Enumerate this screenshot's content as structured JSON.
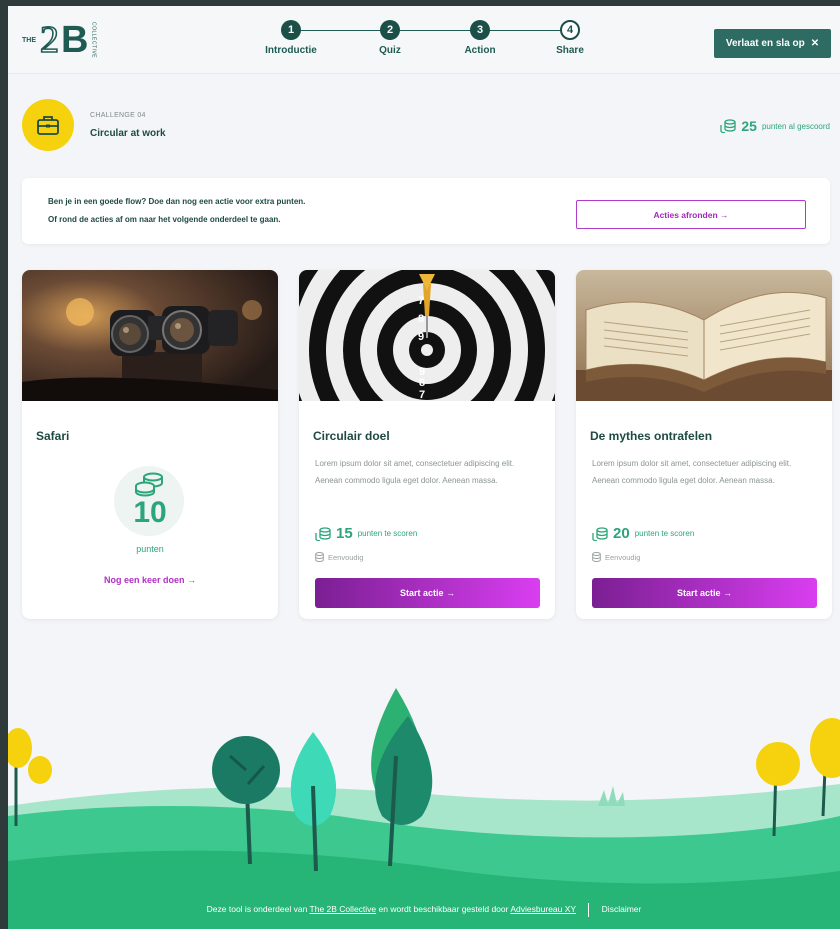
{
  "header": {
    "logo": {
      "the": "THE",
      "two": "2",
      "b": "B",
      "collective": "COLLECTIVE"
    },
    "steps": [
      {
        "number": "1",
        "label": "Introductie",
        "state": "done"
      },
      {
        "number": "2",
        "label": "Quiz",
        "state": "done"
      },
      {
        "number": "3",
        "label": "Action",
        "state": "current"
      },
      {
        "number": "4",
        "label": "Share",
        "state": "todo"
      }
    ],
    "save_button": "Verlaat en sla op",
    "save_icon": "close-icon"
  },
  "challenge": {
    "label": "CHALLENGE 04",
    "title": "Circular at work",
    "icon": "briefcase-icon",
    "points": "25",
    "points_text": "punten al gescoord"
  },
  "banner": {
    "line1": "Ben je in een goede flow? Doe dan nog een actie voor extra punten.",
    "line2": "Of rond de acties af om naar het volgende onderdeel te gaan.",
    "button": "Acties afronden →"
  },
  "cards": [
    {
      "title": "Safari",
      "image": "binoculars-photo",
      "points": "10",
      "points_label": "punten",
      "again_link": "Nog een keer doen →"
    },
    {
      "title": "Circulair doel",
      "image": "dartboard-photo",
      "description": "Lorem ipsum dolor sit amet, consectetuer adipiscing elit. Aenean commodo ligula eget dolor. Aenean massa.",
      "points": "15",
      "points_text": "punten te scoren",
      "level": "Eenvoudig",
      "button": "Start actie →"
    },
    {
      "title": "De mythes ontrafelen",
      "image": "open-book-photo",
      "description": "Lorem ipsum dolor sit amet, consectetuer adipiscing elit. Aenean commodo ligula eget dolor. Aenean massa.",
      "points": "20",
      "points_text": "punten te scoren",
      "level": "Eenvoudig",
      "button": "Start actie →"
    }
  ],
  "footer": {
    "prefix": "Deze tool is onderdeel van",
    "link1": "The 2B Collective",
    "middle": "en wordt beschikbaar gesteld door",
    "link2": "Adviesbureau XY",
    "disclaimer": "Disclaimer"
  },
  "colors": {
    "brand_green": "#1e5b52",
    "accent_green": "#2ca57a",
    "accent_purple": "#b13acb",
    "badge_yellow": "#f5d20d"
  }
}
